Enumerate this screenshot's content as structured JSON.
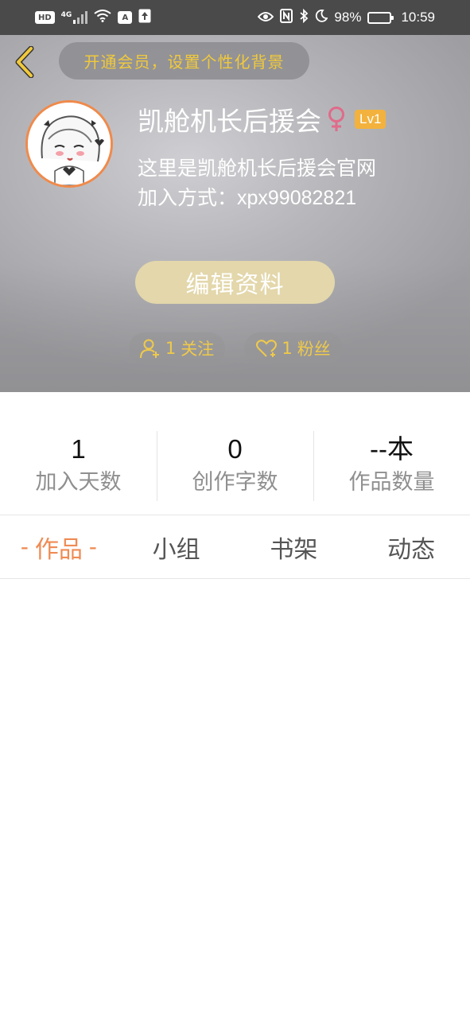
{
  "status_bar": {
    "left_hd": "HD",
    "network_type": "4G",
    "badge_a": "A",
    "battery_percent": "98%",
    "battery_level": 0.98,
    "time": "10:59",
    "icons": [
      "hd-icon",
      "signal-icon",
      "wifi-icon",
      "a-badge-icon",
      "upload-icon",
      "eye-icon",
      "nfc-icon",
      "bluetooth-icon",
      "moon-icon",
      "battery-icon"
    ]
  },
  "header": {
    "back_icon": "chevron-left-icon",
    "vip_banner": "开通会员，设置个性化背景",
    "username": "凯舱机长后援会",
    "gender_icon": "female-icon",
    "level": "Lv1",
    "bio_line1": "这里是凯舱机长后援会官网",
    "bio_line2": "加入方式：xpx99082821",
    "edit_button": "编辑资料",
    "follow_count": "1",
    "follow_label": "关注",
    "fans_count": "1",
    "fans_label": "粉丝",
    "colors": {
      "accent_gold": "#f1c93b",
      "level_badge": "#f3b23d",
      "avatar_ring": "#f08a4b",
      "gender_pink": "#e06b8a"
    }
  },
  "stats": [
    {
      "value": "1",
      "label": "加入天数"
    },
    {
      "value": "0",
      "label": "创作字数"
    },
    {
      "value": "--本",
      "label": "作品数量"
    }
  ],
  "tabs": [
    {
      "label": "作品",
      "active": true,
      "dash": "-"
    },
    {
      "label": "小组",
      "active": false
    },
    {
      "label": "书架",
      "active": false
    },
    {
      "label": "动态",
      "active": false
    }
  ],
  "theme": {
    "tab_active": "#ef8b54",
    "tab_inactive": "#555555"
  }
}
